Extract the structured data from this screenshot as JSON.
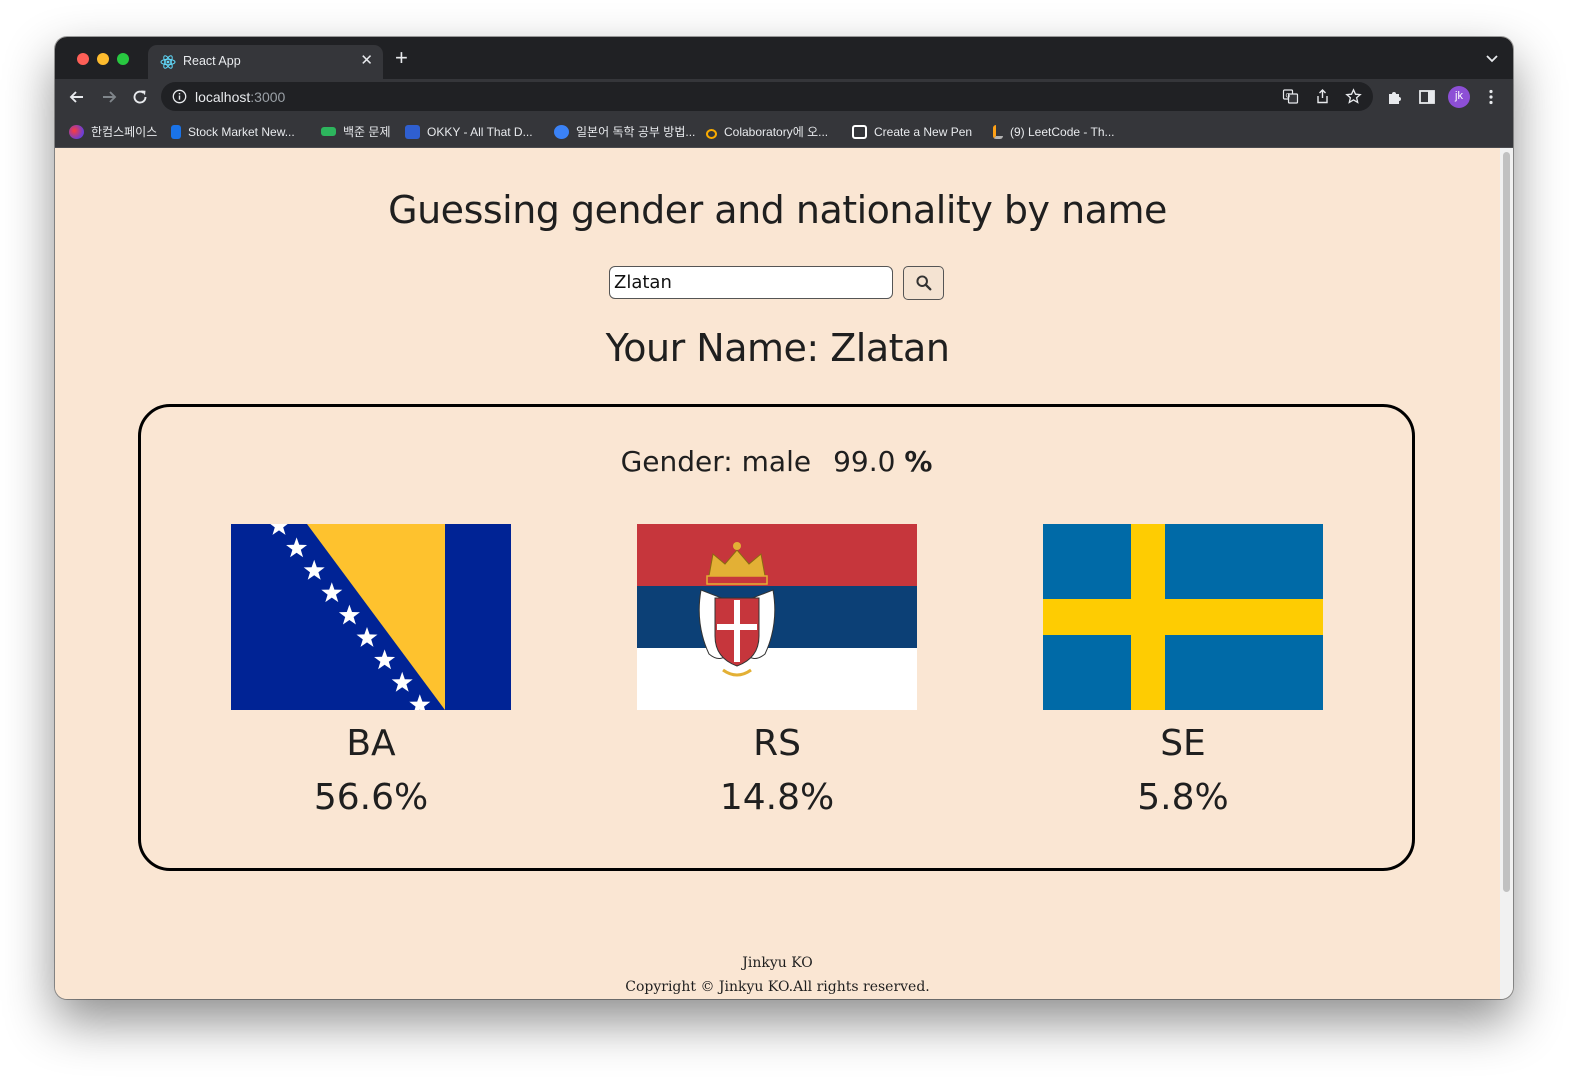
{
  "browser": {
    "tab_title": "React App",
    "url_host": "localhost",
    "url_port": ":3000",
    "avatar_initials": "jk",
    "bookmarks": [
      {
        "label": "한컴스페이스",
        "color": "#6b3fd6"
      },
      {
        "label": "Stock Market New...",
        "color": "#1a73e8"
      },
      {
        "label": "백준 문제",
        "color": "#2db55d"
      },
      {
        "label": "OKKY - All That D...",
        "color": "#2f5fd0"
      },
      {
        "label": "일본어 독학 공부 방법...",
        "color": "#3b82f6"
      },
      {
        "label": "Colaboratory에 오...",
        "color": "#f9ab00"
      },
      {
        "label": "Create a New Pen",
        "color": "#ffffff"
      },
      {
        "label": "(9) LeetCode - Th...",
        "color": "#ffa116"
      }
    ]
  },
  "page": {
    "heading": "Guessing gender and nationality by name",
    "search_value": "Zlatan",
    "your_name": "Your Name: Zlatan",
    "gender_label": "Gender: male",
    "gender_probability": "99.0",
    "percent_symbol": "%",
    "countries": [
      {
        "code": "BA",
        "percent": "56.6%",
        "flag": "bosnia-herzegovina"
      },
      {
        "code": "RS",
        "percent": "14.8%",
        "flag": "serbia"
      },
      {
        "code": "SE",
        "percent": "5.8%",
        "flag": "sweden"
      }
    ],
    "footer_name": "Jinkyu KO",
    "footer_copyright": "Copyright © Jinkyu KO.All rights reserved."
  },
  "colors": {
    "page_background": "#fae6d3",
    "browser_dark": "#202124",
    "toolbar": "#35363a"
  }
}
